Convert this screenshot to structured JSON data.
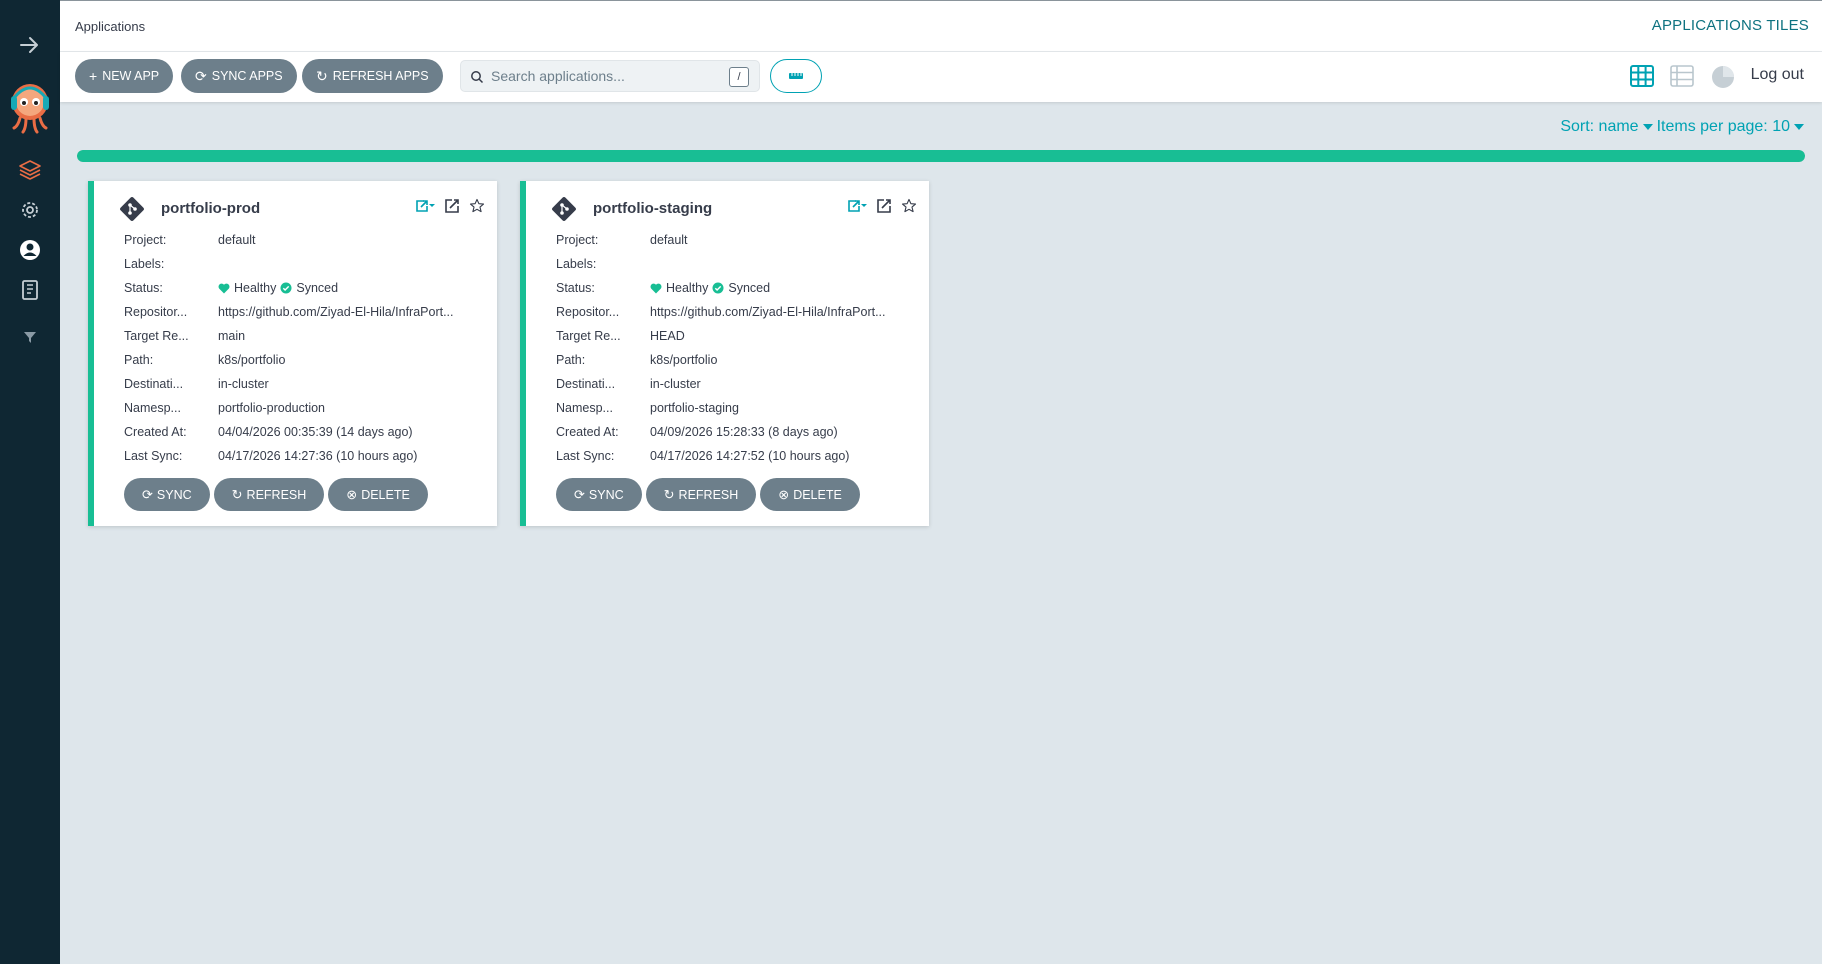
{
  "header": {
    "title": "Applications",
    "view_title": "APPLICATIONS TILES"
  },
  "toolbar": {
    "new_app": "NEW APP",
    "sync_apps": "SYNC APPS",
    "refresh_apps": "REFRESH APPS",
    "search_placeholder": "Search applications...",
    "search_shortcut": "/",
    "logout": "Log out"
  },
  "sortbar": {
    "sort": "Sort: name",
    "per_page": "Items per page: 10"
  },
  "progress": {
    "fraction": 1.0,
    "color": "#18be94"
  },
  "colors": {
    "accent": "#00a2b3",
    "healthy": "#18be94",
    "sidebar": "#0f2733",
    "button": "#6d7f8b"
  },
  "labels": {
    "project": "Project:",
    "labels": "Labels:",
    "status": "Status:",
    "repository": "Repositor...",
    "target": "Target Re...",
    "path": "Path:",
    "destination": "Destinati...",
    "namespace": "Namesp...",
    "created": "Created At:",
    "last_sync": "Last Sync:"
  },
  "card_buttons": {
    "sync": "SYNC",
    "refresh": "REFRESH",
    "delete": "DELETE"
  },
  "apps": [
    {
      "name": "portfolio-prod",
      "project": "default",
      "labels": "",
      "health": "Healthy",
      "sync": "Synced",
      "repository": "https://github.com/Ziyad-El-Hila/InfraPort...",
      "target": "main",
      "path": "k8s/portfolio",
      "destination": "in-cluster",
      "namespace": "portfolio-production",
      "created": "04/04/2026 00:35:39  (14 days ago)",
      "last_sync": "04/17/2026 14:27:36  (10 hours ago)"
    },
    {
      "name": "portfolio-staging",
      "project": "default",
      "labels": "",
      "health": "Healthy",
      "sync": "Synced",
      "repository": "https://github.com/Ziyad-El-Hila/InfraPort...",
      "target": "HEAD",
      "path": "k8s/portfolio",
      "destination": "in-cluster",
      "namespace": "portfolio-staging",
      "created": "04/09/2026 15:28:33  (8 days ago)",
      "last_sync": "04/17/2026 14:27:52  (10 hours ago)"
    }
  ]
}
